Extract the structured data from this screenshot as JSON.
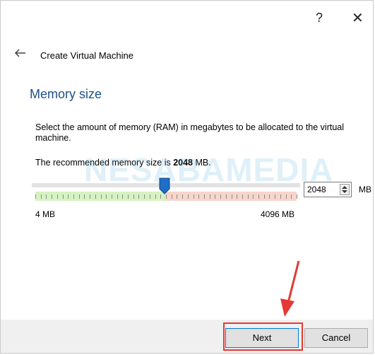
{
  "window": {
    "help_label": "?",
    "close_label": "✕"
  },
  "wizard": {
    "title": "Create Virtual Machine",
    "back_icon": "back-arrow-icon"
  },
  "page": {
    "title": "Memory size",
    "description": "Select the amount of memory (RAM) in megabytes to be allocated to the virtual machine.",
    "recommended_prefix": "The recommended memory size is ",
    "recommended_value": "2048",
    "recommended_suffix": " MB."
  },
  "memory": {
    "min_label": "4 MB",
    "max_label": "4096 MB",
    "value": "2048",
    "unit": "MB",
    "slider_fraction": 0.5
  },
  "watermark": "NESABAMEDIA",
  "buttons": {
    "next": "Next",
    "cancel": "Cancel"
  },
  "colors": {
    "title_blue": "#1e4f8a",
    "thumb_blue": "#1f6fc5",
    "scale_green": "#d6f2c2",
    "scale_red": "#f7d5cc",
    "annotation_red": "#e53935"
  }
}
